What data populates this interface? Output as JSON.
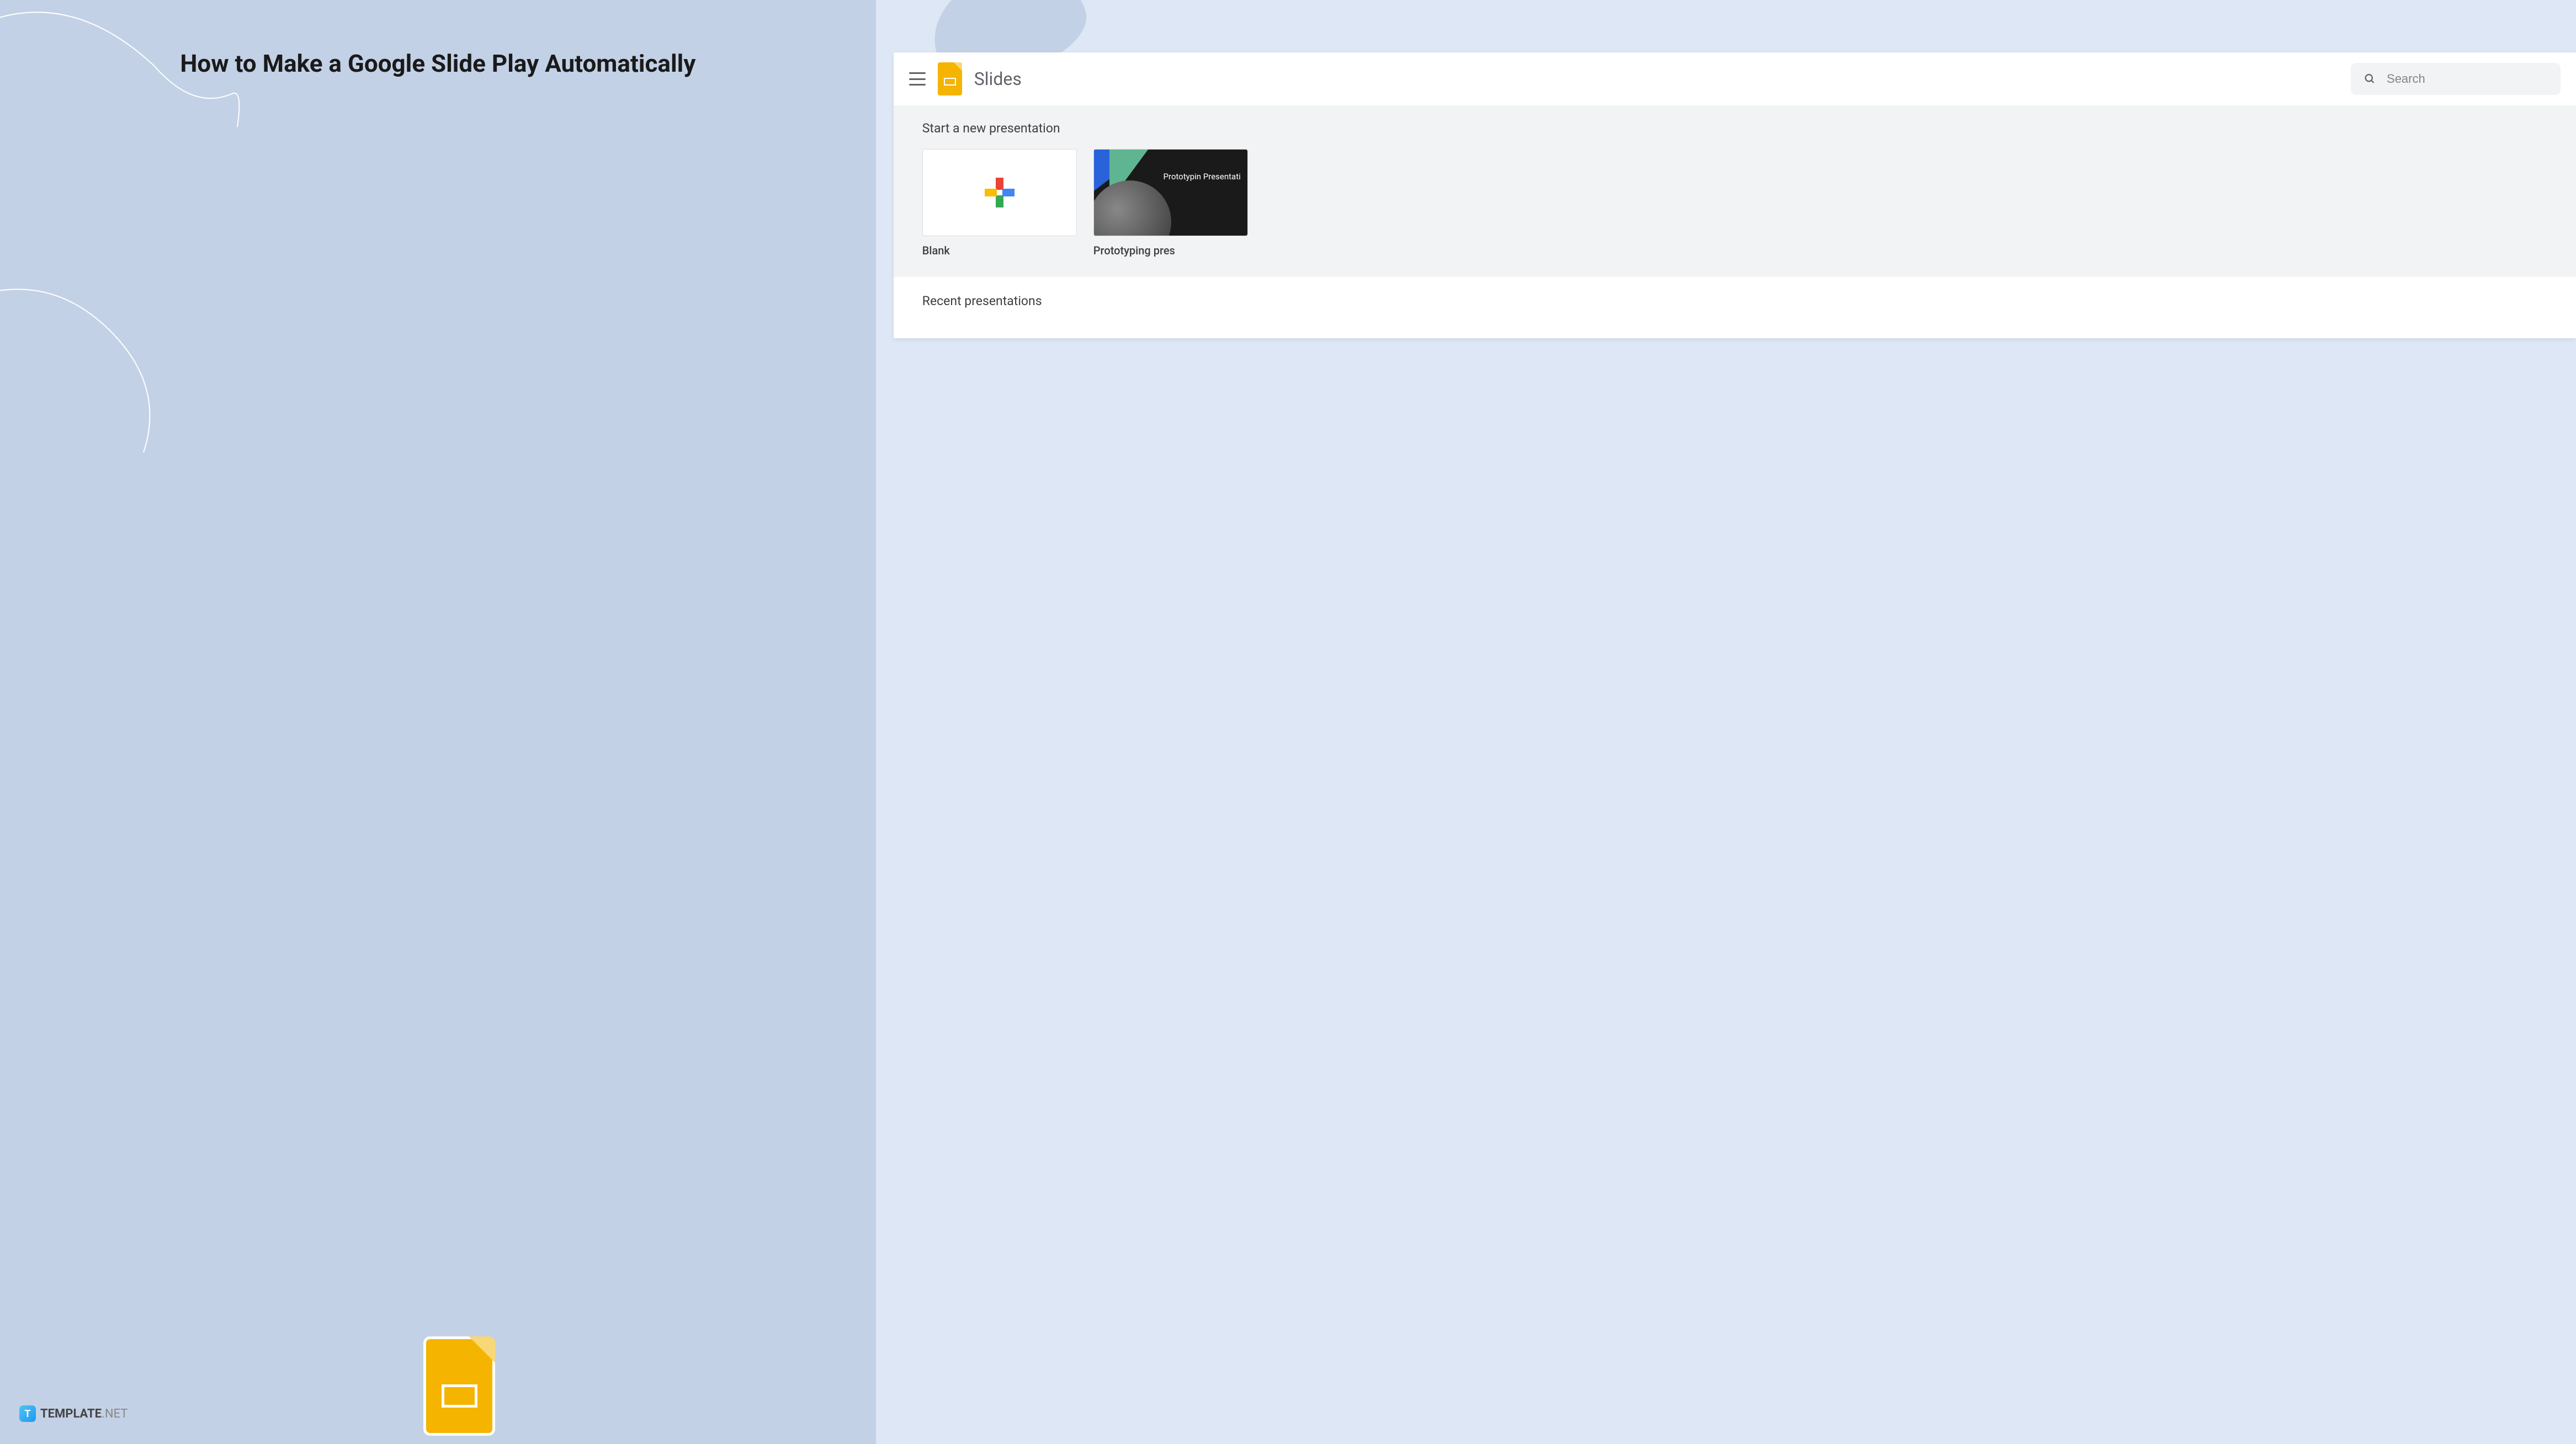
{
  "left": {
    "title": "How to Make a Google Slide Play Automatically",
    "brand_name": "TEMPLATE",
    "brand_suffix": ".NET",
    "brand_icon_letter": "T"
  },
  "app": {
    "title": "Slides",
    "search": {
      "placeholder": "Search"
    },
    "start_section": {
      "heading": "Start a new presentation",
      "templates": [
        {
          "label": "Blank"
        },
        {
          "label": "Prototyping pres",
          "thumb_text": "Prototypin\nPresentati"
        }
      ]
    },
    "recent_section": {
      "heading": "Recent presentations"
    }
  },
  "colors": {
    "slides_yellow": "#f4b400",
    "bg_light_blue": "#dde7f5",
    "bg_muted_blue": "#c3d1e6"
  }
}
